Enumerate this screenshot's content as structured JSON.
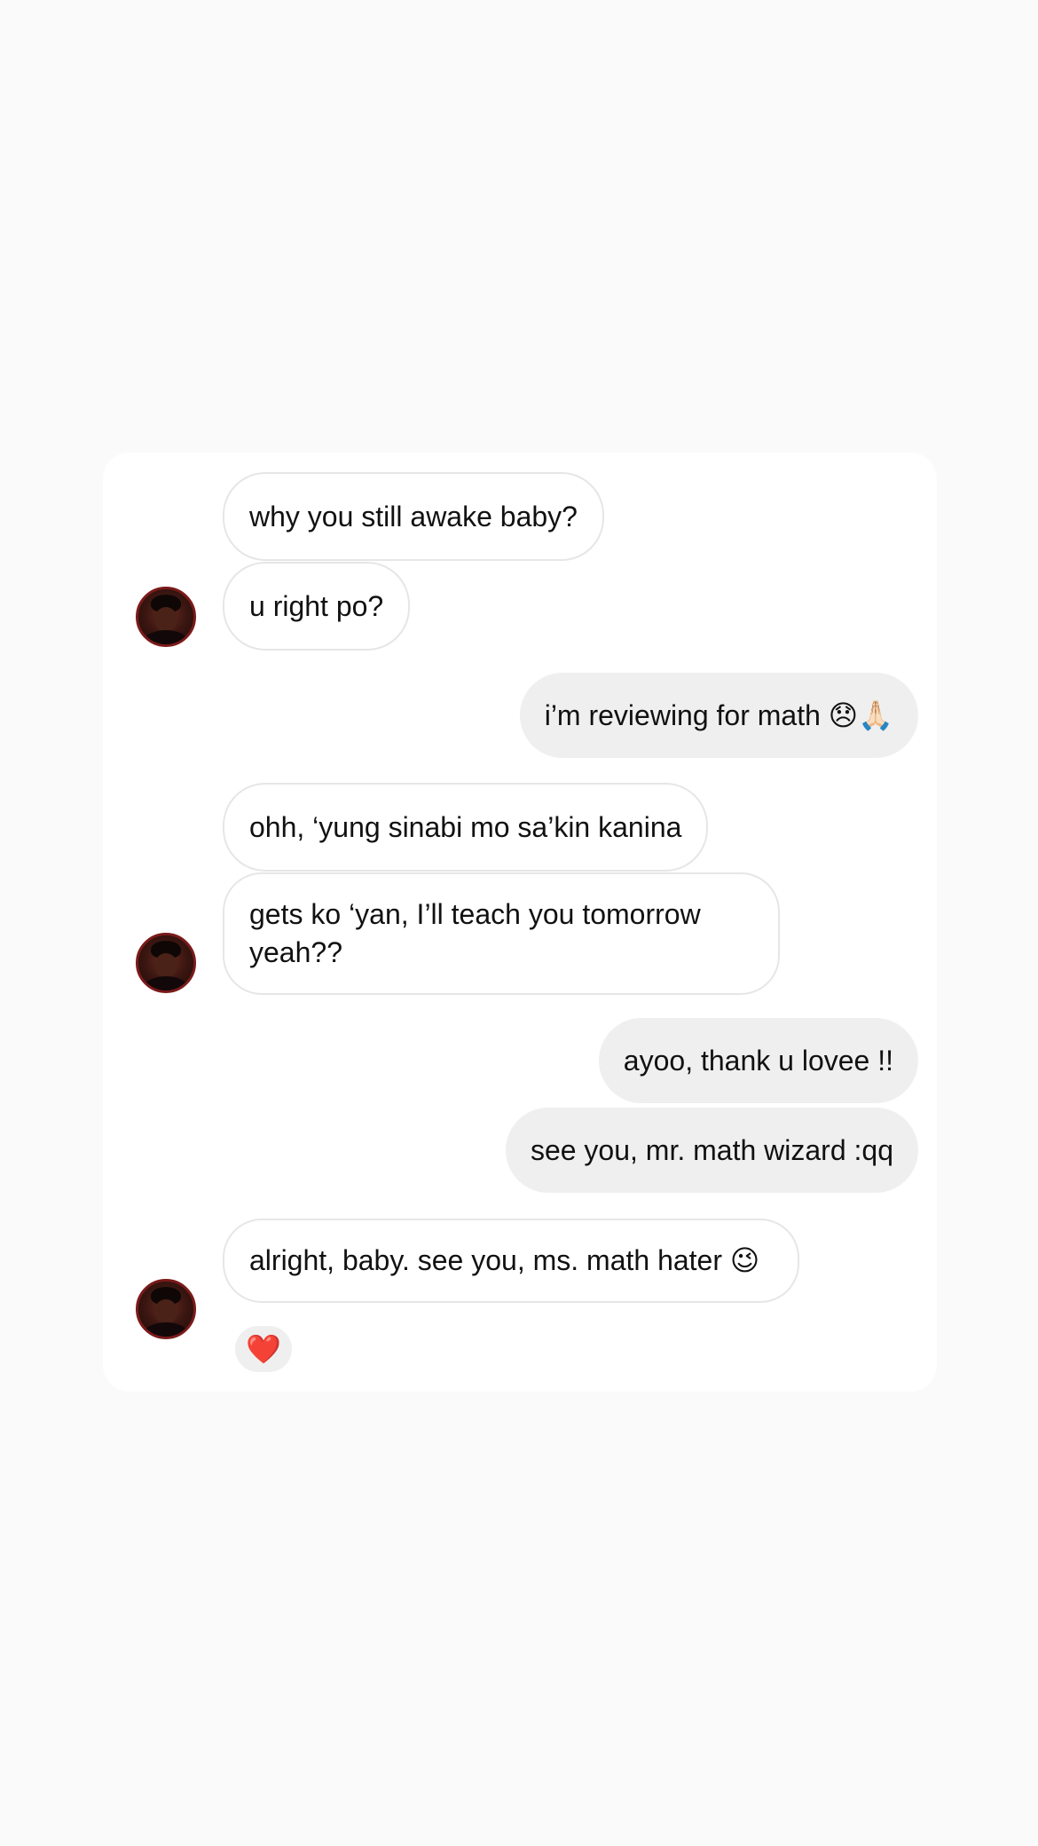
{
  "messages": [
    {
      "sender": "them",
      "text": "why you still awake baby?"
    },
    {
      "sender": "them",
      "text": "u right po?"
    },
    {
      "sender": "me",
      "text": "i’m reviewing for math 😞🙏🏻"
    },
    {
      "sender": "them",
      "text": "ohh, ‘yung sinabi mo sa’kin kanina"
    },
    {
      "sender": "them",
      "text": "gets ko ‘yan, I’ll teach you tomorrow yeah??"
    },
    {
      "sender": "me",
      "text": "ayoo, thank u lovee !!"
    },
    {
      "sender": "me",
      "text": "see you, mr. math wizard :qq"
    },
    {
      "sender": "them",
      "text": "alright, baby. see you, ms. math hater 😉"
    }
  ],
  "reaction": {
    "emoji": "❤️",
    "on_message_index": 7
  },
  "colors": {
    "page_background": "#fafafa",
    "card_background": "#ffffff",
    "incoming_border": "#e6e6e6",
    "outgoing_bubble": "#efefef"
  },
  "icons": {
    "avatar": "contact-avatar",
    "reaction": "red-heart"
  }
}
